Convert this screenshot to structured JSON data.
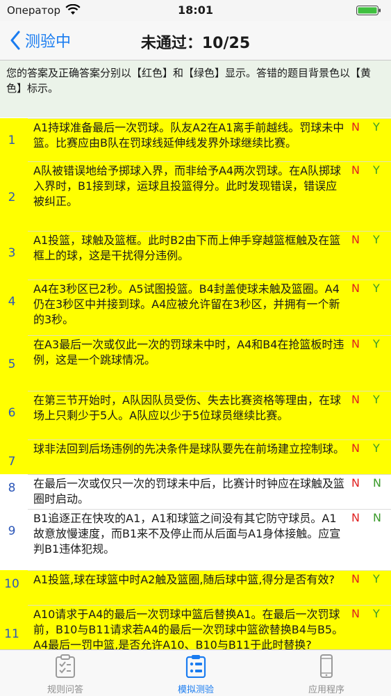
{
  "status": {
    "carrier": "Оператор",
    "time": "18:01"
  },
  "nav": {
    "back_label": "测验中",
    "title": "未通过：10/25"
  },
  "notice": "您的答案及正确答案分别以【红色】和【绿色】显示。答错的题目背景色以【黄色】标示。",
  "colors": {
    "accent": "#1a7cf0",
    "wrong_bg": "#ffff00",
    "user_answer": "#e02020",
    "correct_answer": "#3a9a2a",
    "notice_bg": "#ebf3e9"
  },
  "questions": [
    {
      "num": "1",
      "text": "A1持球准备最后一次罚球。队友A2在A1离手前越线。罚球未中篮。比赛应由B队在罚球线延伸线发界外球继续比赛。",
      "user": "N",
      "correct": "Y",
      "wrong": true
    },
    {
      "num": "2",
      "text": "A队被错误地给予掷球入界，而非给予A4两次罚球。在A队掷球入界时，B1接到球，运球且投篮得分。此时发现错误，错误应被纠正。",
      "user": "N",
      "correct": "Y",
      "wrong": true
    },
    {
      "num": "3",
      "text": "A1投篮，球触及篮框。此时B2由下而上伸手穿越篮框触及在篮框上的球，这是干扰得分违例。",
      "user": "N",
      "correct": "Y",
      "wrong": true
    },
    {
      "num": "4",
      "text": "A4在3秒区已2秒。A5试图投篮。B4封盖使球未触及篮圈。A4仍在3秒区中并接到球。A4应被允许留在3秒区，并拥有一个新的3秒。",
      "user": "N",
      "correct": "Y",
      "wrong": true
    },
    {
      "num": "5",
      "text": "在A3最后一次或仅此一次的罚球未中时，A4和B4在抢篮板时违例，这是一个跳球情况。",
      "user": "N",
      "correct": "Y",
      "wrong": true
    },
    {
      "num": "6",
      "text": "在第三节开始时，A队因队员受伤、失去比赛资格等理由，在球场上只剩少于5人。A队应以少于5位球员继续比赛。",
      "user": "N",
      "correct": "Y",
      "wrong": true
    },
    {
      "num": "7",
      "text": "球非法回到后场违例的先决条件是球队要先在前场建立控制球。",
      "user": "N",
      "correct": "Y",
      "wrong": true
    },
    {
      "num": "8",
      "text": "在最后一次或仅只一次的罚球未中后，比赛计时钟应在球触及篮圈时启动。",
      "user": "N",
      "correct": "N",
      "wrong": false
    },
    {
      "num": "9",
      "text": "B1追逐正在快攻的A1，A1和球篮之间没有其它防守球员。A1故意放慢速度，而B1来不及停止而从后面与A1身体接触。应宣判B1违体犯规。",
      "user": "N",
      "correct": "N",
      "wrong": false
    },
    {
      "num": "10",
      "text": "A1投篮,球在球篮中时A2触及篮圈,随后球中篮,得分是否有效?",
      "user": "N",
      "correct": "Y",
      "wrong": true
    },
    {
      "num": "11",
      "text": "A10请求于A4的最后一次罚球中篮后替换A1。在最后一次罚球前，B10与B11请求若A4的最后一次罚球中篮欲替换B4与B5。A4最后一罚中篮,是否允许A10、B10与B11于此时替换?",
      "user": "N",
      "correct": "Y",
      "wrong": true
    }
  ],
  "tabs": [
    {
      "label": "规则问答",
      "icon": "clipboard-check-icon",
      "active": false
    },
    {
      "label": "模拟测验",
      "icon": "clipboard-list-icon",
      "active": true
    },
    {
      "label": "应用程序",
      "icon": "phone-icon",
      "active": false
    }
  ]
}
